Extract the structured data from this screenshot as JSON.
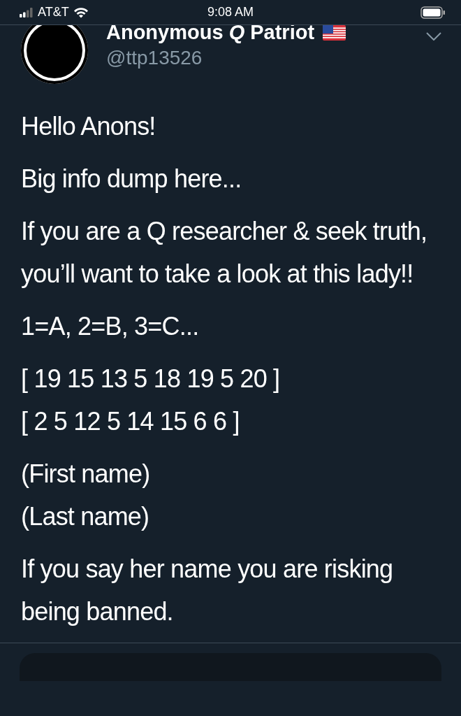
{
  "status_bar": {
    "carrier": "AT&T",
    "time": "9:08 AM"
  },
  "author": {
    "name": "Anonymous *Q* Patriot",
    "handle": "@ttp13526"
  },
  "tweet": {
    "paragraphs": [
      "Hello Anons!",
      "Big info dump here...",
      "If you are a Q researcher & seek truth, you’ll want to take a look at this lady!!",
      "1=A, 2=B, 3=C...",
      "[ 19 15 13 5 18 19 5 20 ]\n[ 2 5 12 5 14 15 6 6 ]",
      "(First name)\n(Last name)",
      "If you say her name you are risking being banned."
    ]
  }
}
